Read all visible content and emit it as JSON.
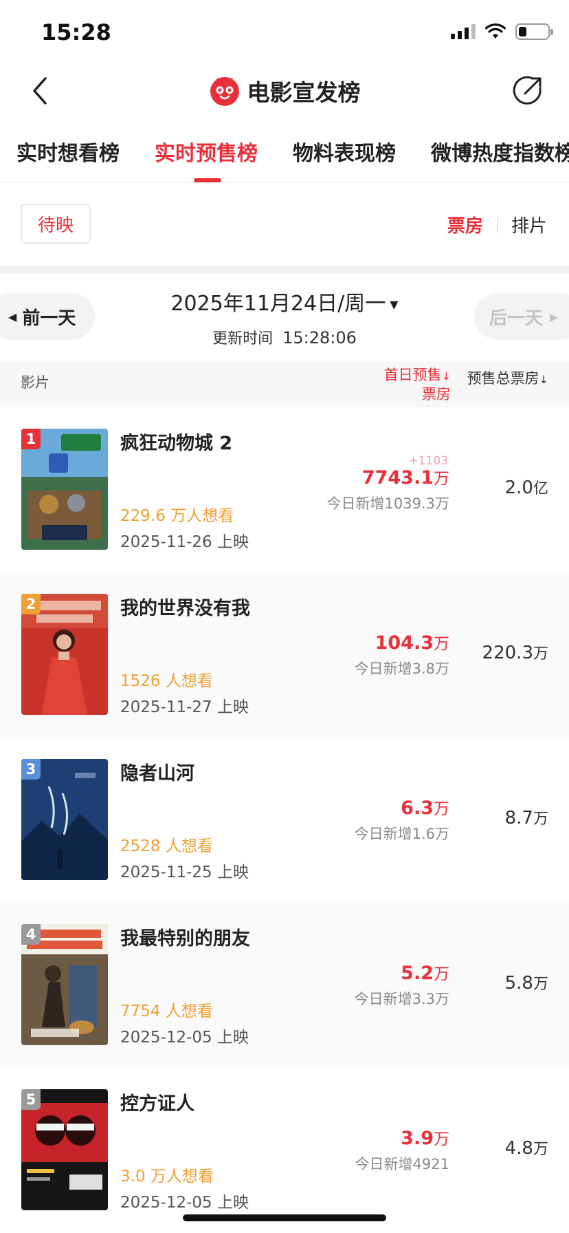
{
  "status_bar": {
    "time": "15:28",
    "battery_level": 0.28
  },
  "nav": {
    "title": "电影宣发榜",
    "back_icon": "chevron-left-icon",
    "share_icon": "share-icon",
    "logo_icon": "cat-logo-icon"
  },
  "tabs": [
    {
      "label": "实时想看榜",
      "active": false
    },
    {
      "label": "实时预售榜",
      "active": true
    },
    {
      "label": "物料表现榜",
      "active": false
    },
    {
      "label": "微博热度指数榜",
      "active": false
    }
  ],
  "filter": {
    "chip": "待映",
    "metric_on": "票房",
    "metric_off": "排片"
  },
  "date": {
    "prev": "前一天",
    "next": "后一天",
    "main": "2025年11月24日/周一",
    "update_label": "更新时间",
    "update_time": "15:28:06"
  },
  "table_header": {
    "film": "影片",
    "first_day_line1": "首日预售",
    "first_day_line2": "票房",
    "total": "预售总票房",
    "sort_mark": "↓"
  },
  "rows": [
    {
      "rank": "1",
      "title": "疯狂动物城 2",
      "wish": "229.6 万人想看",
      "release": "2025-11-26 上映",
      "delta": "+1103",
      "first_value": "7743.1",
      "first_unit": "万",
      "today": "今日新增1039.3万",
      "total_value": "2.0",
      "total_unit": "亿",
      "rank_color": "#e8303b"
    },
    {
      "rank": "2",
      "title": "我的世界没有我",
      "wish": "1526 人想看",
      "release": "2025-11-27 上映",
      "delta": "",
      "first_value": "104.3",
      "first_unit": "万",
      "today": "今日新增3.8万",
      "total_value": "220.3",
      "total_unit": "万",
      "rank_color": "#f0a035"
    },
    {
      "rank": "3",
      "title": "隐者山河",
      "wish": "2528 人想看",
      "release": "2025-11-25 上映",
      "delta": "",
      "first_value": "6.3",
      "first_unit": "万",
      "today": "今日新增1.6万",
      "total_value": "8.7",
      "total_unit": "万",
      "rank_color": "#5b8fd6"
    },
    {
      "rank": "4",
      "title": "我最特别的朋友",
      "wish": "7754 人想看",
      "release": "2025-12-05 上映",
      "delta": "",
      "first_value": "5.2",
      "first_unit": "万",
      "today": "今日新增3.3万",
      "total_value": "5.8",
      "total_unit": "万",
      "rank_color": "#9a9a9a"
    },
    {
      "rank": "5",
      "title": "控方证人",
      "wish": "3.0 万人想看",
      "release": "2025-12-05 上映",
      "delta": "",
      "first_value": "3.9",
      "first_unit": "万",
      "today": "今日新增4921",
      "total_value": "4.8",
      "total_unit": "万",
      "rank_color": "#9a9a9a"
    }
  ],
  "colors": {
    "accent": "#e8303b",
    "wish": "#f0a035",
    "muted": "#888888"
  }
}
